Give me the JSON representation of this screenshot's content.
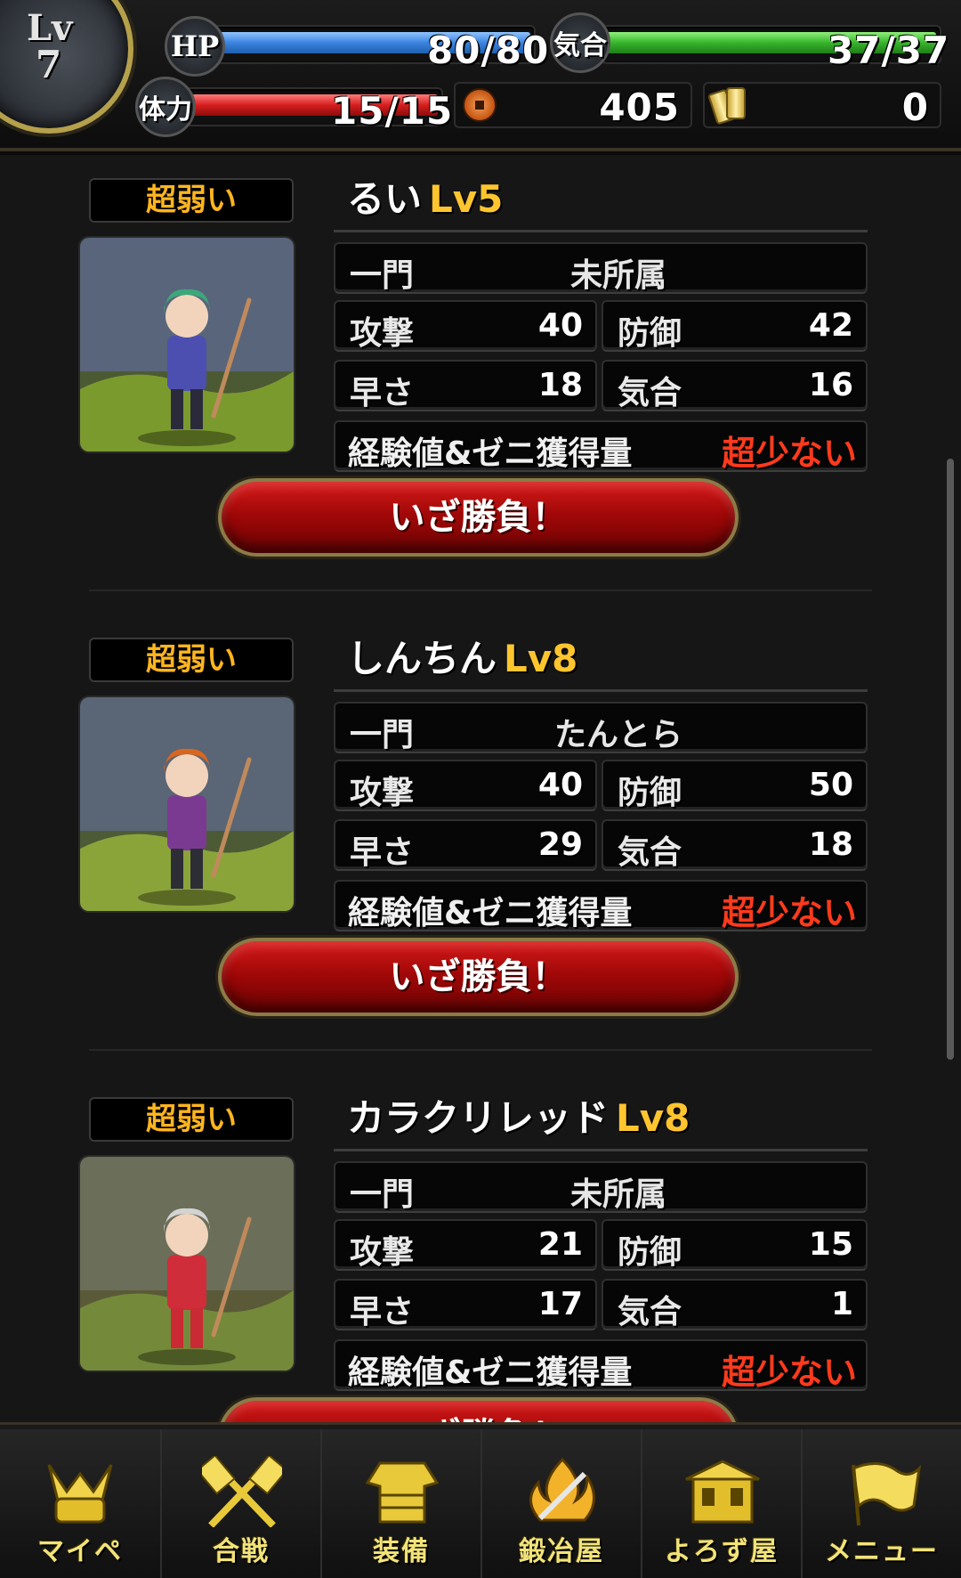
{
  "header": {
    "lv_label": "Lv",
    "lv_value": "7",
    "hp_label": "HP",
    "hp_value": "80/80",
    "hp_fill": 1.0,
    "ki_label": "気合",
    "ki_value": "37/37",
    "ki_fill": 1.0,
    "stamina_label": "体力",
    "stamina_value": "15/15",
    "stamina_fill": 1.0,
    "zeni": "405",
    "gold": "0"
  },
  "labels": {
    "faction": "一門",
    "attack": "攻撃",
    "defense": "防御",
    "speed": "早さ",
    "spirit": "気合",
    "exp": "経験値&ゼニ獲得量",
    "fight_button": "いざ勝負！"
  },
  "enemies": [
    {
      "tier": "超弱い",
      "name": "るい",
      "level": "Lv5",
      "faction": "未所属",
      "attack": "40",
      "defense": "42",
      "speed": "18",
      "spirit": "16",
      "exp_reward": "超少ない"
    },
    {
      "tier": "超弱い",
      "name": "しんちん",
      "level": "Lv8",
      "faction": "たんとら",
      "attack": "40",
      "defense": "50",
      "speed": "29",
      "spirit": "18",
      "exp_reward": "超少ない"
    },
    {
      "tier": "超弱い",
      "name": "カラクリレッド",
      "level": "Lv8",
      "faction": "未所属",
      "attack": "21",
      "defense": "15",
      "speed": "17",
      "spirit": "1",
      "exp_reward": "超少ない"
    }
  ],
  "nav": [
    {
      "label": "マイペ",
      "icon": "samurai-helmet-icon"
    },
    {
      "label": "合戦",
      "icon": "crossed-banners-icon"
    },
    {
      "label": "装備",
      "icon": "armor-icon"
    },
    {
      "label": "鍛冶屋",
      "icon": "forge-flame-icon"
    },
    {
      "label": "よろず屋",
      "icon": "shop-icon"
    },
    {
      "label": "メニュー",
      "icon": "flag-icon"
    }
  ]
}
